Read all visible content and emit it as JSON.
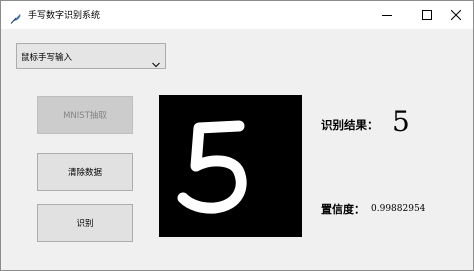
{
  "window": {
    "title": "手写数字识别系统",
    "icons": {
      "app": "feather-app-icon",
      "minimize": "minimize-icon",
      "maximize": "maximize-icon",
      "close": "close-icon"
    }
  },
  "input_mode": {
    "selected": "鼠标手写输入",
    "icon": "chevron-down-icon"
  },
  "buttons": {
    "mnist": "MNIST抽取",
    "mnist_enabled": false,
    "clear": "清除数据",
    "recognize": "识别"
  },
  "canvas": {
    "drawn_digit": "5",
    "background": "#000000",
    "stroke_color": "#ffffff"
  },
  "result": {
    "label": "识别结果：",
    "value": "5",
    "confidence_label": "置信度：",
    "confidence_value": "0.99882954"
  }
}
